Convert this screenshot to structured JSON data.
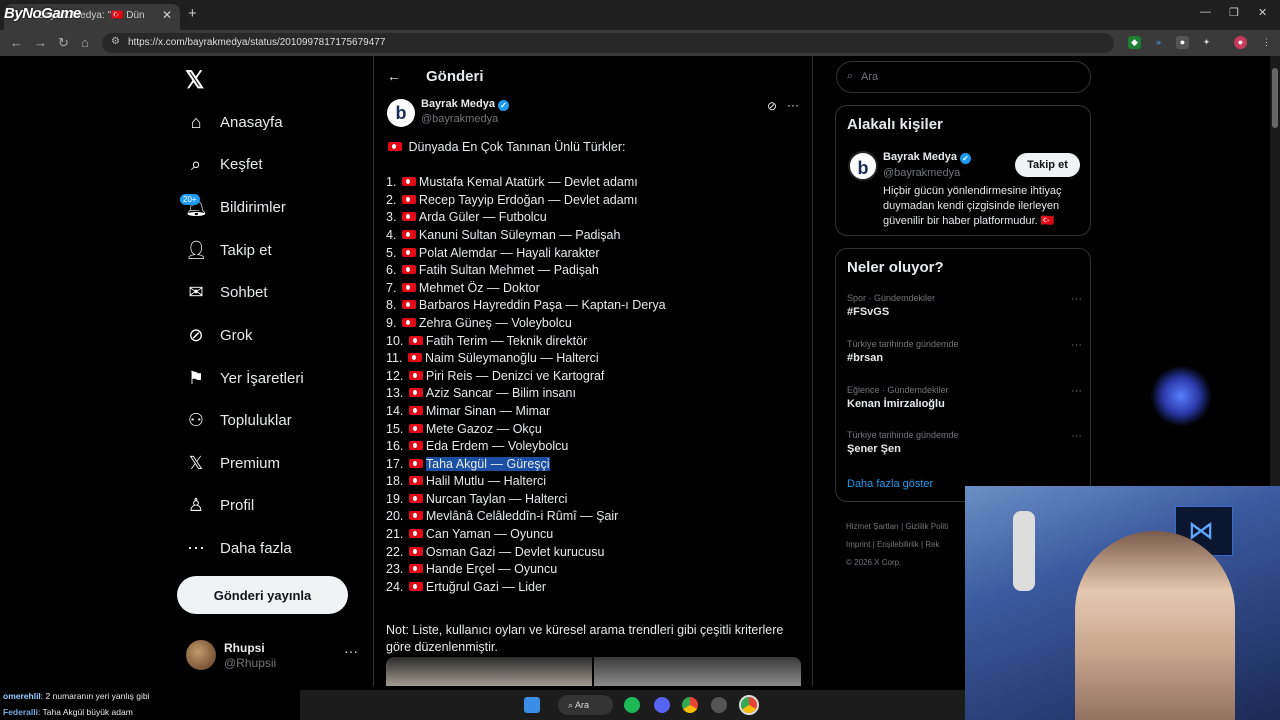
{
  "browser": {
    "tab_title": "Bayrak Medya: \"🇹🇷 Dün",
    "overlay_logo": "ByNoGame",
    "url": "https://x.com/bayrakmedya/status/2010997817175679477"
  },
  "nav": {
    "logo": "𝕏",
    "items": [
      {
        "label": "Anasayfa",
        "icon": "home-icon"
      },
      {
        "label": "Keşfet",
        "icon": "search-icon"
      },
      {
        "label": "Bildirimler",
        "icon": "bell-icon"
      },
      {
        "label": "Takip et",
        "icon": "follow-icon"
      },
      {
        "label": "Sohbet",
        "icon": "mail-icon"
      },
      {
        "label": "Grok",
        "icon": "grok-icon"
      },
      {
        "label": "Yer İşaretleri",
        "icon": "bookmark-icon"
      },
      {
        "label": "Topluluklar",
        "icon": "communities-icon"
      },
      {
        "label": "Premium",
        "icon": "x-icon"
      },
      {
        "label": "Profil",
        "icon": "profile-icon"
      },
      {
        "label": "Daha fazla",
        "icon": "more-icon"
      }
    ],
    "notif_badge": "20+",
    "post_button": "Gönderi yayınla",
    "profile_name": "Rhupsi",
    "profile_handle": "@Rhupsii"
  },
  "post": {
    "header_title": "Gönderi",
    "author_name": "Bayrak Medya",
    "author_handle": "@bayrakmedya",
    "headline": "Dünyada En Çok Tanınan Ünlü Türkler:",
    "list": [
      {
        "n": "1.",
        "text": "Mustafa Kemal Atatürk — Devlet adamı"
      },
      {
        "n": "2.",
        "text": "Recep Tayyip Erdoğan — Devlet adamı"
      },
      {
        "n": "3.",
        "text": "Arda Güler — Futbolcu"
      },
      {
        "n": "4.",
        "text": "Kanuni Sultan Süleyman — Padişah"
      },
      {
        "n": "5.",
        "text": "Polat Alemdar — Hayali karakter"
      },
      {
        "n": "6.",
        "text": "Fatih Sultan Mehmet — Padişah"
      },
      {
        "n": "7.",
        "text": "Mehmet Öz — Doktor"
      },
      {
        "n": "8.",
        "text": "Barbaros Hayreddin Paşa — Kaptan-ı Derya"
      },
      {
        "n": "9.",
        "text": "Zehra Güneş — Voleybolcu"
      },
      {
        "n": "10.",
        "text": "Fatih Terim — Teknik direktör"
      },
      {
        "n": "11.",
        "text": "Naim Süleymanoğlu — Halterci"
      },
      {
        "n": "12.",
        "text": "Piri Reis — Denizci ve Kartograf"
      },
      {
        "n": "13.",
        "text": "Aziz Sancar — Bilim insanı"
      },
      {
        "n": "14.",
        "text": "Mimar Sinan — Mimar"
      },
      {
        "n": "15.",
        "text": "Mete Gazoz — Okçu"
      },
      {
        "n": "16.",
        "text": "Eda Erdem — Voleybolcu"
      },
      {
        "n": "17.",
        "text": "Taha Akgül — Güreşçi",
        "highlighted": true
      },
      {
        "n": "18.",
        "text": "Halil Mutlu — Halterci"
      },
      {
        "n": "19.",
        "text": "Nurcan Taylan — Halterci"
      },
      {
        "n": "20.",
        "text": "Mevlânâ Celâleddîn-i Rûmî — Şair"
      },
      {
        "n": "21.",
        "text": "Can Yaman — Oyuncu"
      },
      {
        "n": "22.",
        "text": "Osman Gazi — Devlet kurucusu"
      },
      {
        "n": "23.",
        "text": "Hande Erçel — Oyuncu"
      },
      {
        "n": "24.",
        "text": "Ertuğrul Gazi — Lider"
      }
    ],
    "note": "Not: Liste, kullanıcı oyları ve küresel arama trendleri gibi çeşitli kriterlere göre düzenlenmiştir."
  },
  "sidebar": {
    "search_placeholder": "Ara",
    "related_title": "Alakalı kişiler",
    "related_name": "Bayrak Medya",
    "related_handle": "@bayrakmedya",
    "follow_button": "Takip et",
    "related_bio": "Hiçbir gücün yönlendirmesine ihtiyaç duymadan kendi çizgisinde ilerleyen güvenilir bir haber platformudur. 🇹🇷",
    "trends_title": "Neler oluyor?",
    "trends": [
      {
        "context": "Spor · Gündemdekiler",
        "name": "#FSvGS"
      },
      {
        "context": "Türkiye tarihinde gündemde",
        "name": "#brsan"
      },
      {
        "context": "Eğlence · Gündemdekiler",
        "name": "Kenan İmirzalıoğlu"
      },
      {
        "context": "Türkiye tarihinde gündemde",
        "name": "Şener Şen"
      }
    ],
    "show_more": "Daha fazla göster",
    "footer_1": "Hizmet Şartları | Gizlilik Politi",
    "footer_2": "Imprint | Erişilebilirlik | Rek",
    "footer_3": "© 2026 X Corp."
  },
  "chat": [
    {
      "user": "omerehlil",
      "msg": ": 2 numaranın yeri yanlış gibi"
    },
    {
      "user": "Federalli",
      "msg": ": Taha Akgül büyük adam"
    }
  ],
  "taskbar": {
    "search": "Ara"
  }
}
